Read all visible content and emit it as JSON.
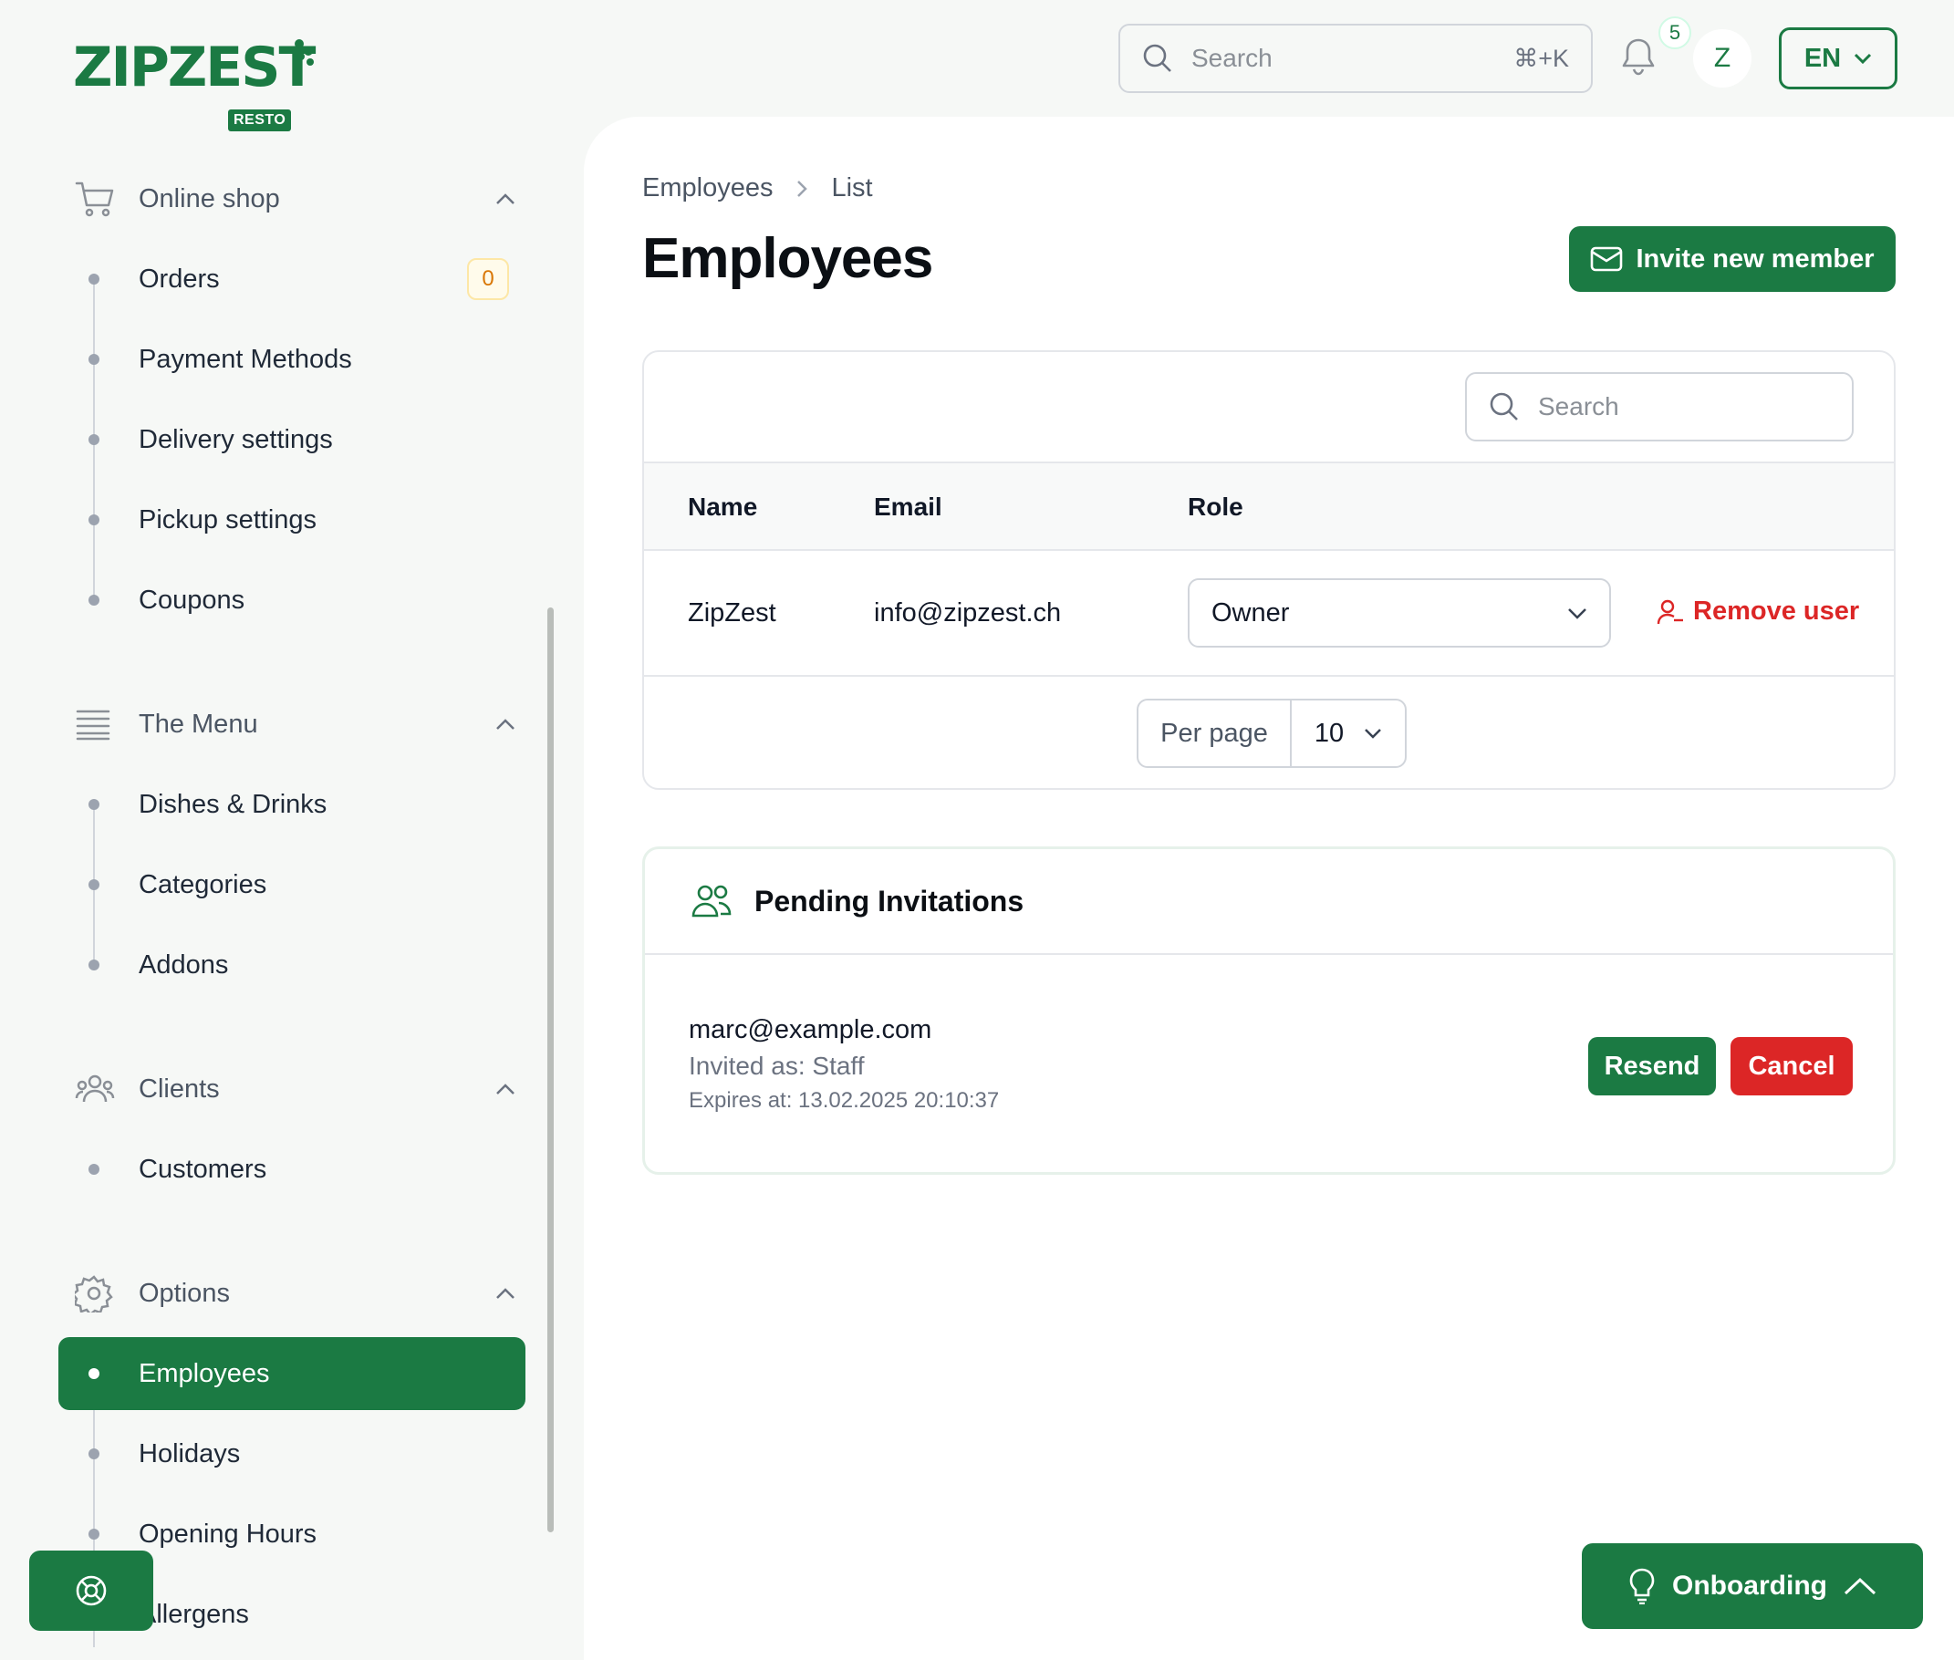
{
  "brand": {
    "name": "ZIPZEST",
    "badge": "RESTO",
    "accent": "#1b7a43"
  },
  "topbar": {
    "search_placeholder": "Search",
    "search_shortcut": "⌘+K",
    "notification_count": "5",
    "avatar_initial": "Z",
    "language": "EN"
  },
  "sidebar": {
    "groups": [
      {
        "label": "Online shop",
        "icon": "cart-icon",
        "items": [
          "Orders",
          "Payment Methods",
          "Delivery settings",
          "Pickup settings",
          "Coupons"
        ]
      },
      {
        "label": "The Menu",
        "icon": "menu-list-icon",
        "items": [
          "Dishes & Drinks",
          "Categories",
          "Addons"
        ]
      },
      {
        "label": "Clients",
        "icon": "users-icon",
        "items": [
          "Customers"
        ]
      },
      {
        "label": "Options",
        "icon": "gear-icon",
        "items": [
          "Employees",
          "Holidays",
          "Opening Hours",
          "Allergens"
        ]
      }
    ],
    "orders_badge": "0",
    "active_item": "Employees"
  },
  "breadcrumb": {
    "parent": "Employees",
    "current": "List"
  },
  "page": {
    "title": "Employees",
    "invite_label": "Invite new member"
  },
  "employees_table": {
    "search_placeholder": "Search",
    "columns": [
      "Name",
      "Email",
      "Role"
    ],
    "rows": [
      {
        "name": "ZipZest",
        "email": "info@zipzest.ch",
        "role": "Owner",
        "action": "Remove user"
      }
    ],
    "per_page_label": "Per page",
    "per_page_value": "10"
  },
  "pending": {
    "title": "Pending Invitations",
    "invitations": [
      {
        "email": "marc@example.com",
        "invited_as": "Invited as: Staff",
        "expires": "Expires at: 13.02.2025 20:10:37",
        "resend_label": "Resend",
        "cancel_label": "Cancel"
      }
    ]
  },
  "onboarding_label": "Onboarding"
}
